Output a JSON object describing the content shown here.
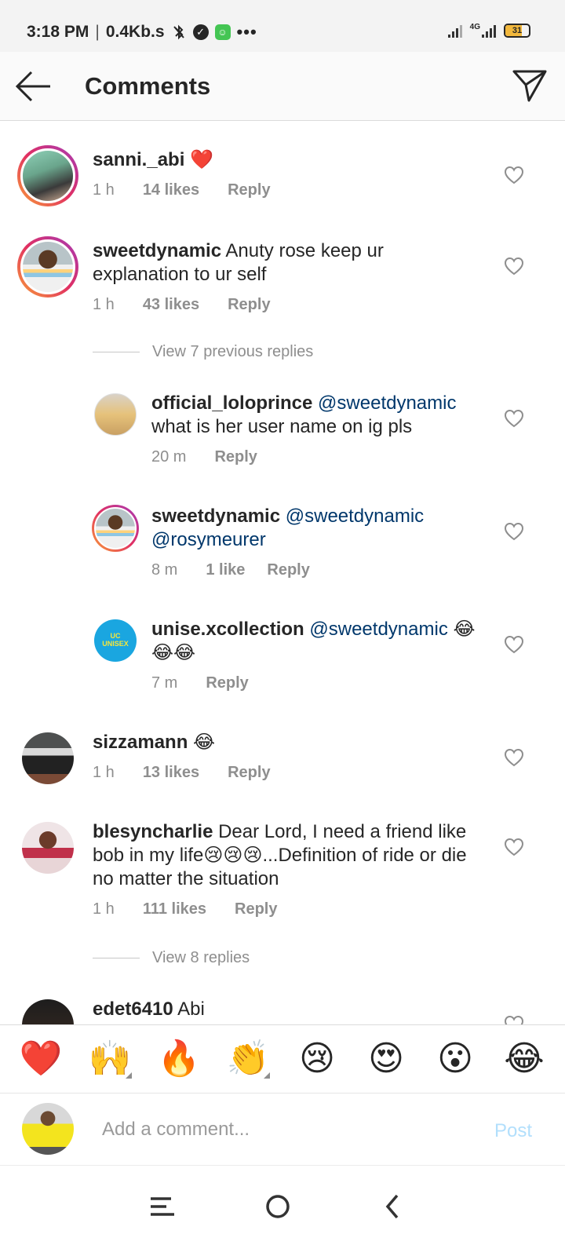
{
  "status_bar": {
    "time": "3:18 PM",
    "speed": "0.4Kb.s",
    "network": "4G",
    "battery": "31"
  },
  "header": {
    "title": "Comments"
  },
  "comments": [
    {
      "username": "sanni._abi",
      "text": "❤️",
      "time": "1 h",
      "likes": "14 likes",
      "reply": "Reply"
    },
    {
      "username": "sweetdynamic",
      "text": "Anuty rose keep ur explanation to ur self",
      "time": "1 h",
      "likes": "43 likes",
      "reply": "Reply"
    }
  ],
  "view_previous_replies": "View 7 previous replies",
  "replies": [
    {
      "username": "official_loloprince",
      "mention": "@sweetdynamic",
      "text": "what is her user name on ig pls",
      "time": "20 m",
      "likes": "",
      "reply": "Reply"
    },
    {
      "username": "sweetdynamic",
      "mention": "@sweetdynamic @rosymeurer",
      "text": "",
      "time": "8 m",
      "likes": "1 like",
      "reply": "Reply"
    },
    {
      "username": "unise.xcollection",
      "mention": "@sweetdynamic",
      "text": "😂😂😂",
      "time": "7 m",
      "likes": "",
      "reply": "Reply"
    }
  ],
  "comments_after": [
    {
      "username": "sizzamann",
      "text": "😂",
      "time": "1 h",
      "likes": "13 likes",
      "reply": "Reply"
    },
    {
      "username": "blesyncharlie",
      "text": "Dear Lord, I need a friend like bob in my life😢😢😢...Definition of ride or die no matter the situation",
      "time": "1 h",
      "likes": "111 likes",
      "reply": "Reply"
    }
  ],
  "view_replies": "View 8 replies",
  "partial_comment": {
    "username": "edet6410",
    "text": "Abi"
  },
  "emoji_bar": [
    "❤️",
    "🙌",
    "🔥",
    "👏",
    "😢",
    "😍",
    "😮",
    "😂"
  ],
  "composer": {
    "placeholder": "Add a comment...",
    "post_label": "Post"
  },
  "colors": {
    "link": "#00376b",
    "muted": "#8e8e8e",
    "post_disabled": "#b2dffc"
  }
}
